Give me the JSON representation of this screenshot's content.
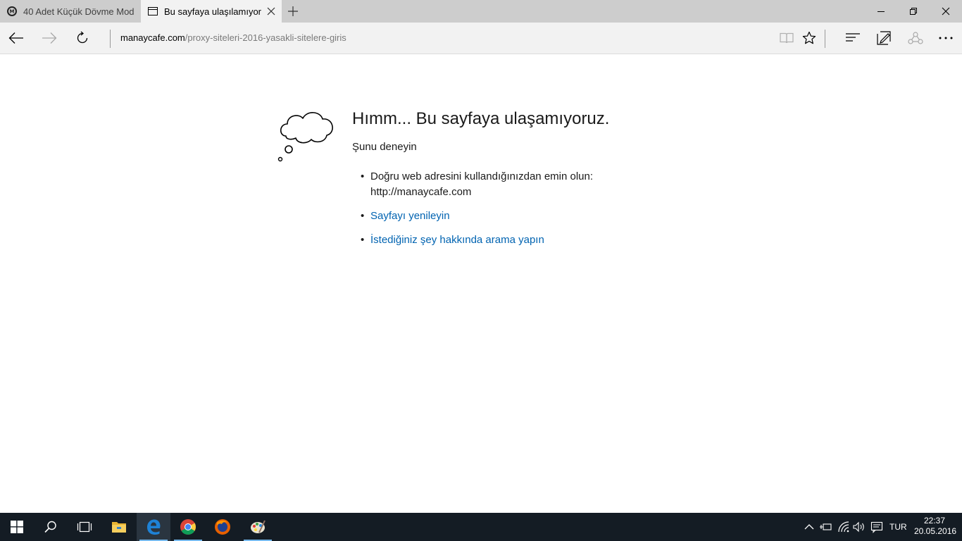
{
  "tabs": [
    {
      "title": "40 Adet Küçük Dövme Mod",
      "active": false,
      "favicon": "site-favicon-icon"
    },
    {
      "title": "Bu sayfaya ulaşılamıyor",
      "active": true,
      "favicon": "page-icon"
    }
  ],
  "address": {
    "host": "manaycafe.com",
    "path": "/proxy-siteleri-2016-yasakli-sitelere-giris"
  },
  "error_page": {
    "title": "Hımm... Bu sayfaya ulaşamıyoruz.",
    "subtitle": "Şunu deneyin",
    "suggestions": [
      {
        "line1": "Doğru web adresini kullandığınızdan emin olun:",
        "line2": "http://manaycafe.com"
      },
      {
        "link": "Sayfayı yenileyin"
      },
      {
        "link": "İstediğiniz şey hakkında arama yapın"
      }
    ]
  },
  "taskbar": {
    "apps": [
      "start-icon",
      "search-icon",
      "task-view-icon",
      "file-explorer-icon",
      "edge-icon",
      "chrome-icon",
      "firefox-icon",
      "paint-icon"
    ],
    "language": "TUR",
    "time": "22:37",
    "date": "20.05.2016"
  },
  "colors": {
    "link": "#0063b1",
    "tabbar": "#cdcdcd",
    "chrome_bg": "#f2f2f2",
    "taskbar": "#141c24",
    "taskbar_active_indicator": "#76b9ed"
  }
}
